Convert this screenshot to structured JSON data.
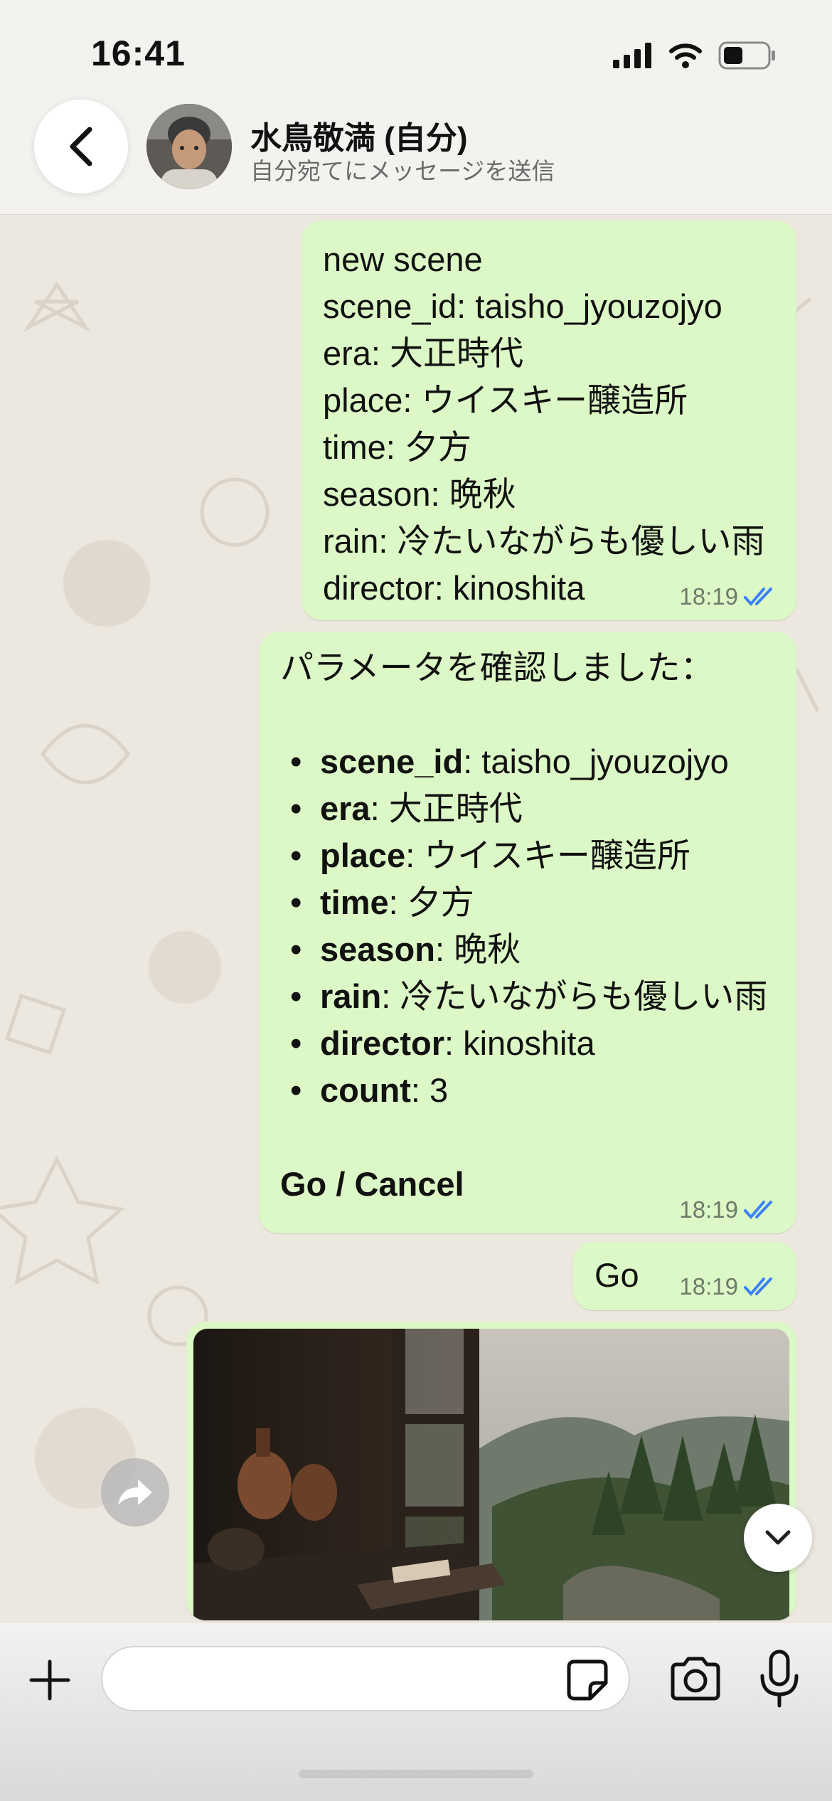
{
  "status_bar": {
    "time": "16:41"
  },
  "header": {
    "contact_name": "水鳥敬満 (自分)",
    "subtitle": "自分宛てにメッセージを送信"
  },
  "messages": [
    {
      "lines": [
        "new scene",
        "scene_id: taisho_jyouzojyo",
        "era: 大正時代",
        "place: ウイスキー醸造所",
        "time: 夕方",
        "season: 晩秋",
        "rain: 冷たいながらも優しい雨",
        "director: kinoshita"
      ],
      "time": "18:19"
    },
    {
      "intro": "パラメータを確認しました：",
      "params": [
        {
          "key": "scene_id",
          "value": ": taisho_jyouzojyo"
        },
        {
          "key": "era",
          "value": ": 大正時代"
        },
        {
          "key": "place",
          "value": ": ウイスキー醸造所"
        },
        {
          "key": "time",
          "value": ": 夕方"
        },
        {
          "key": "season",
          "value": ": 晩秋"
        },
        {
          "key": "rain",
          "value": ": 冷たいながらも優しい雨"
        },
        {
          "key": "director",
          "value": ": kinoshita"
        },
        {
          "key": "count",
          "value": ": 3"
        }
      ],
      "actions": "Go / Cancel",
      "time": "18:19"
    },
    {
      "text": "Go",
      "time": "18:19"
    }
  ],
  "composer": {
    "placeholder": ""
  },
  "colors": {
    "bubble_out": "#dcf8c6",
    "read_ticks": "#3b82f6",
    "background": "#efeae2"
  },
  "icons": [
    "back-chevron-icon",
    "signal-icon",
    "wifi-icon",
    "battery-icon",
    "double-check-icon",
    "forward-icon",
    "chevron-down-icon",
    "plus-icon",
    "sticker-icon",
    "camera-icon",
    "mic-icon"
  ]
}
